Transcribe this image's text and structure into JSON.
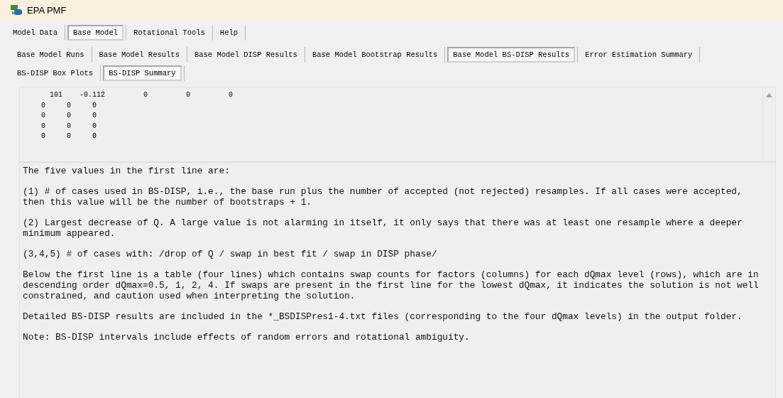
{
  "window": {
    "title": "EPA PMF"
  },
  "menu_tabs": [
    {
      "label": "Model Data",
      "selected": false
    },
    {
      "label": "Base Model",
      "selected": true
    },
    {
      "label": "Rotational Tools",
      "selected": false
    },
    {
      "label": "Help",
      "selected": false
    }
  ],
  "sub_tab_rows": [
    [
      {
        "label": "Base Model Runs",
        "selected": false
      },
      {
        "label": "Base Model Results",
        "selected": false
      },
      {
        "label": "Base Model DISP Results",
        "selected": false
      },
      {
        "label": "Base Model Bootstrap Results",
        "selected": false
      },
      {
        "label": "Base Model BS-DISP Results",
        "selected": true
      },
      {
        "label": "Error Estimation Summary",
        "selected": false
      }
    ],
    [
      {
        "label": "BS-DISP Box Plots",
        "selected": false
      },
      {
        "label": "BS-DISP Summary",
        "selected": true
      }
    ]
  ],
  "summary_output": [
    "     101    -0.112         0         0         0",
    "   0     0     0",
    "   0     0     0",
    "   0     0     0",
    "   0     0     0"
  ],
  "explanation": [
    "The five values in the first line are:",
    "(1) # of cases used in BS-DISP, i.e., the base run plus the number of accepted (not rejected) resamples. If all cases were accepted, then this value will be the number of bootstraps + 1.",
    "(2) Largest decrease of Q. A large value is not alarming in itself, it only says that there was at least one resample where a deeper minimum appeared.",
    "(3,4,5) # of cases with: /drop of Q / swap in best fit / swap in DISP phase/",
    "Below the first line is a table (four lines) which contains swap counts for factors (columns) for each dQmax level (rows), which are in descending order dQmax=0.5, 1, 2, 4. If swaps are present in the first line for the lowest dQmax, it indicates the solution is not well constrained, and caution used when interpreting the solution.",
    "Detailed BS-DISP results are included in the *_BSDISPres1-4.txt files (corresponding to the four dQmax levels) in the output folder.",
    "Note: BS-DISP intervals include effects of random errors and rotational ambiguity."
  ]
}
